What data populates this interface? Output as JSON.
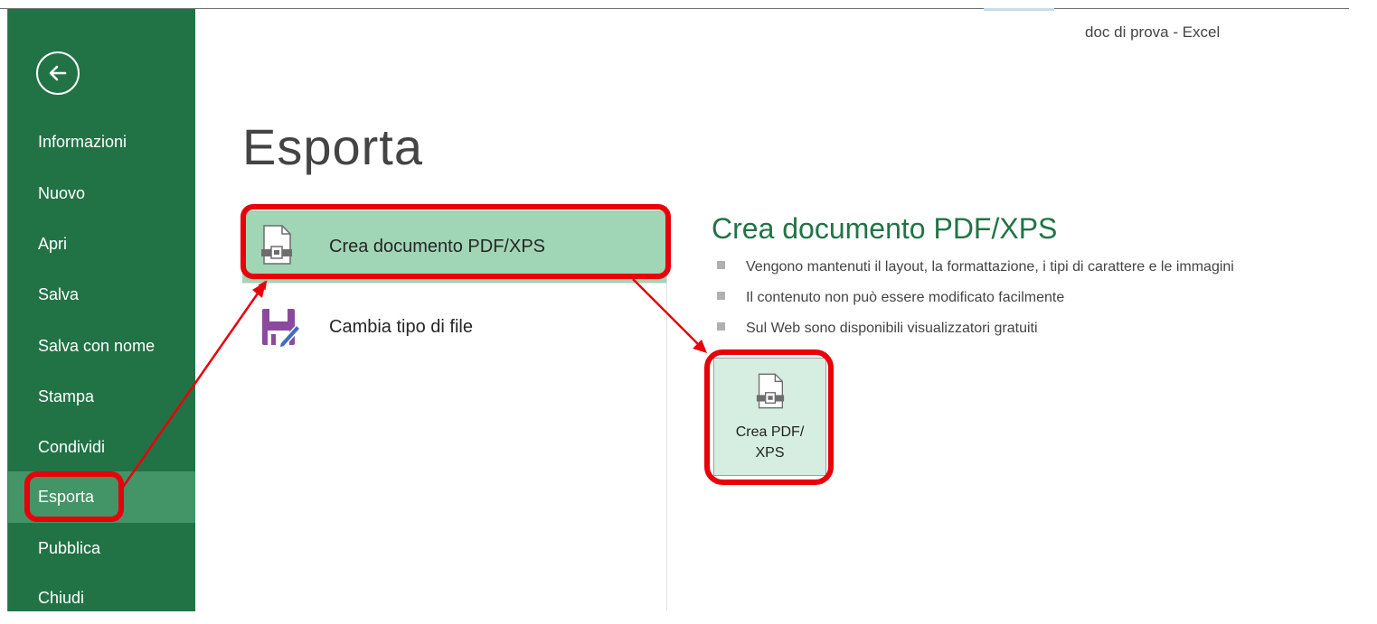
{
  "window": {
    "title": "doc di prova - Excel"
  },
  "sidebar": {
    "back_icon": "arrow-left-icon",
    "items": [
      {
        "label": "Informazioni"
      },
      {
        "label": "Nuovo"
      },
      {
        "label": "Apri"
      },
      {
        "label": "Salva"
      },
      {
        "label": "Salva con nome"
      },
      {
        "label": "Stampa"
      },
      {
        "label": "Condividi"
      },
      {
        "label": "Esporta",
        "active": true
      },
      {
        "label": "Pubblica"
      },
      {
        "label": "Chiudi"
      }
    ],
    "color": "#217346",
    "active_color": "#439467"
  },
  "main": {
    "title": "Esporta",
    "options": [
      {
        "label": "Crea documento PDF/XPS",
        "icon": "pdf-document-icon",
        "selected": true
      },
      {
        "label": "Cambia tipo di file",
        "icon": "save-as-icon",
        "selected": false
      }
    ],
    "detail": {
      "title": "Crea documento PDF/XPS",
      "bullets": [
        "Vengono mantenuti il layout, la formattazione, i tipi di carattere e le immagini",
        "Il contenuto non può essere modificato facilmente",
        "Sul Web sono disponibili visualizzatori gratuiti"
      ],
      "button": {
        "line1": "Crea PDF/",
        "line2": "XPS",
        "icon": "pdf-document-icon"
      }
    }
  },
  "annotation_color": "#e8000b"
}
